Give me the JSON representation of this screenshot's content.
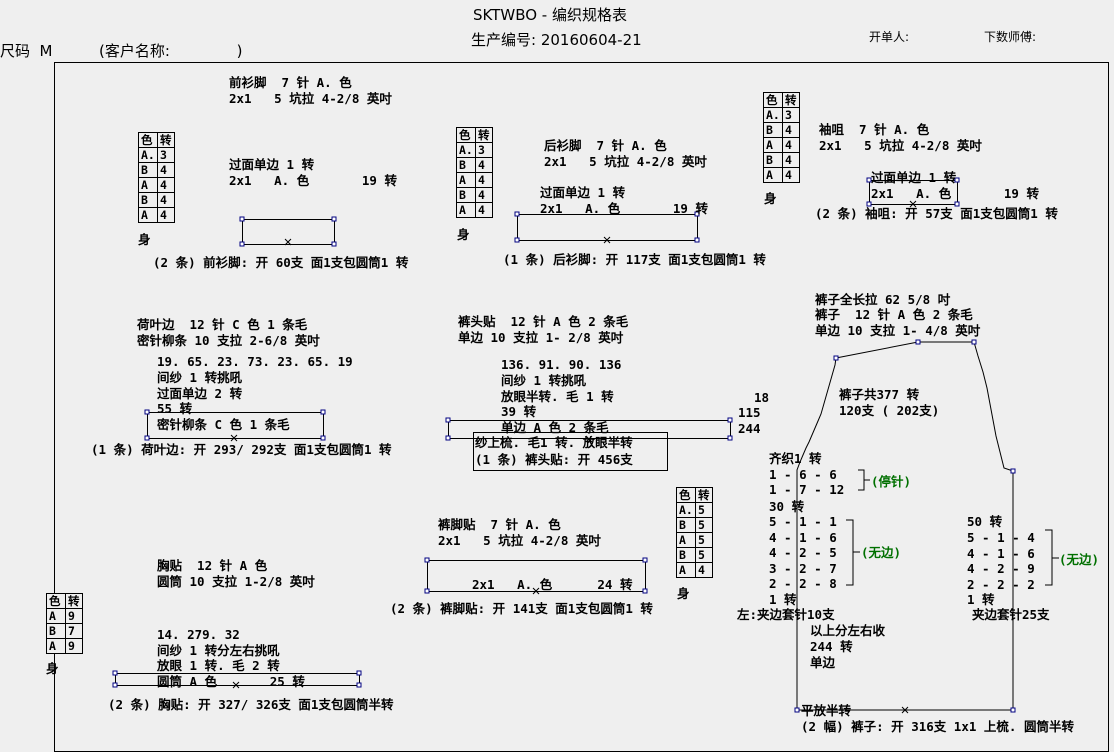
{
  "header": {
    "title": "SKTWBO - 编织规格表",
    "order_no": "生产编号: 20160604-21",
    "size": "尺码  M",
    "customer": "(客户名称:              )",
    "issuer": "开单人:",
    "counter": "下数师傅:"
  },
  "col_head": [
    "色",
    "转"
  ],
  "body_label": "身",
  "tables": {
    "front_hem": [
      [
        "A.",
        "3"
      ],
      [
        "B",
        "4"
      ],
      [
        "A",
        "4"
      ],
      [
        "B",
        "4"
      ],
      [
        "A",
        "4"
      ]
    ],
    "back_hem": [
      [
        "A.",
        "3"
      ],
      [
        "B",
        "4"
      ],
      [
        "A",
        "4"
      ],
      [
        "B",
        "4"
      ],
      [
        "A",
        "4"
      ]
    ],
    "cuff": [
      [
        "A.",
        "3"
      ],
      [
        "B",
        "4"
      ],
      [
        "A",
        "4"
      ],
      [
        "B",
        "4"
      ],
      [
        "A",
        "4"
      ]
    ],
    "pants_hem": [
      [
        "A.",
        "5"
      ],
      [
        "B",
        "5"
      ],
      [
        "A",
        "5"
      ],
      [
        "B",
        "5"
      ],
      [
        "A",
        "4"
      ]
    ],
    "chest": [
      [
        "A",
        "9"
      ],
      [
        "B",
        "7"
      ],
      [
        "A",
        "9"
      ]
    ]
  },
  "texts": {
    "fh1": "前衫脚  7 针 A. 色",
    "fh2": "2x1   5 坑拉 4-2/8 英吋",
    "fh3": "过面单边 1 转",
    "fh4": "2x1   A. 色       19 转",
    "fh5": "(2 条) 前衫脚: 开 60支 面1支包圆筒1 转",
    "bh1": "后衫脚  7 针 A. 色",
    "bh2": "2x1   5 坑拉 4-2/8 英吋",
    "bh3": "过面单边 1 转",
    "bh4": "2x1   A. 色       19 转",
    "bh5": "(1 条) 后衫脚: 开 117支 面1支包圆筒1 转",
    "cu1": "袖咀  7 针 A. 色",
    "cu2": "2x1   5 坑拉 4-2/8 英吋",
    "cu3": "过面单边 1 转",
    "cu4": "2x1   A. 色       19 转",
    "cu5": "(2 条) 袖咀: 开 57支 面1支包圆筒1 转",
    "le1": "荷叶边  12 针 C 色 1 条毛",
    "le2": "密针柳条 10 支拉 2-6/8 英吋",
    "le3": "19. 65. 23. 73. 23. 65. 19",
    "le4": "间纱 1 转挑吼",
    "le5": "过面单边 2 转",
    "le6": "55 转",
    "le7": "密针柳条 C 色 1 条毛",
    "le8": "(1 条) 荷叶边: 开 293/ 292支 面1支包圆筒1 转",
    "wb1": "裤头贴  12 针 A 色 2 条毛",
    "wb2": "单边 10 支拉 1- 2/8 英吋",
    "wb3": "136. 91. 90. 136",
    "wb4": "间纱 1 转挑吼",
    "wb5": "放眼半转. 毛 1 转",
    "wb6": "39 转",
    "wb7": "单边 A 色 2 条毛",
    "wb8": "纱上梳. 毛1 转. 放眼半转",
    "wb9": "(1 条) 裤头贴: 开 456支",
    "wbn1": "18",
    "wbn2": "115",
    "wbn3": "244",
    "ph1": "裤脚贴  7 针 A. 色",
    "ph2": "2x1   5 坑拉 4-2/8 英吋",
    "ph3": "2x1   A. 色      24 转",
    "ph4": "(2 条) 裤脚贴: 开 141支 面1支包圆筒1 转",
    "ch1": "胸贴  12 针 A 色",
    "ch2": "圆筒 10 支拉 1-2/8 英吋",
    "ch3": "14. 279. 32",
    "ch4": "间纱 1 转分左右挑吼",
    "ch5": "放眼 1 转. 毛 2 转",
    "ch6": "圆筒 A 色       25 转",
    "ch7": "(2 条) 胸贴: 开 327/ 326支 面1支包圆筒半转",
    "pa1": "裤子全长拉 62 5/8 吋",
    "pa2": "裤子  12 针 A 色 2 条毛",
    "pa3": "单边 10 支拉 1- 4/8 英吋",
    "pa4": "裤子共377 转",
    "pa5": "120支 ( 202支)",
    "pa6": "齐织1 转",
    "pa7": "1 - 6 - 6",
    "pa8": "1 - 7 - 12",
    "pa9": "(停针)",
    "pa10": "30 转",
    "pa11": "5 - 1 - 1\n4 - 1 - 6\n4 - 2 - 5\n3 - 2 - 7\n2 - 2 - 8",
    "pa12": "(无边)",
    "pa13": "1 转",
    "pa14": "左:夹边套针10支",
    "pa15": "以上分左右收",
    "pa16": "244 转",
    "pa17": "单边",
    "pa18": "50 转",
    "pa19": "5 - 1 - 4\n4 - 1 - 6\n4 - 2 - 9\n2 - 2 - 2",
    "pa20": "(无边)",
    "pa21": "1 转",
    "pa22": "夹边套针25支",
    "pa23": "平放半转",
    "pa24": "(2 幅) 裤子: 开 316支 1x1 上梳. 圆筒半转"
  }
}
